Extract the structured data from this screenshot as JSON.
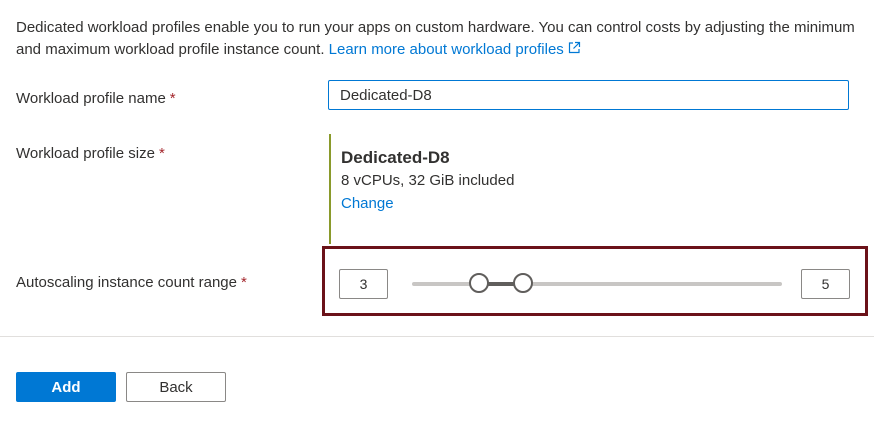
{
  "description": {
    "text": "Dedicated workload profiles enable you to run your apps on custom hardware. You can control costs by adjusting the minimum and maximum workload profile instance count.",
    "link_label": "Learn more about workload profiles",
    "link_icon": "external-link-icon"
  },
  "form": {
    "name": {
      "label": "Workload profile name",
      "required_marker": "*",
      "value": "Dedicated-D8"
    },
    "size": {
      "label": "Workload profile size",
      "required_marker": "*",
      "selected_name": "Dedicated-D8",
      "selected_detail": "8 vCPUs, 32 GiB included",
      "change_label": "Change"
    },
    "autoscale": {
      "label": "Autoscaling instance count range",
      "required_marker": "*",
      "min_value": "3",
      "max_value": "5",
      "range_min_fraction": 0.18,
      "range_max_fraction": 0.3
    }
  },
  "actions": {
    "add_label": "Add",
    "back_label": "Back"
  },
  "colors": {
    "accent": "#0078d4",
    "required": "#a4262c",
    "highlight_border": "#6b1219",
    "size_bar": "#8a9a2b"
  }
}
